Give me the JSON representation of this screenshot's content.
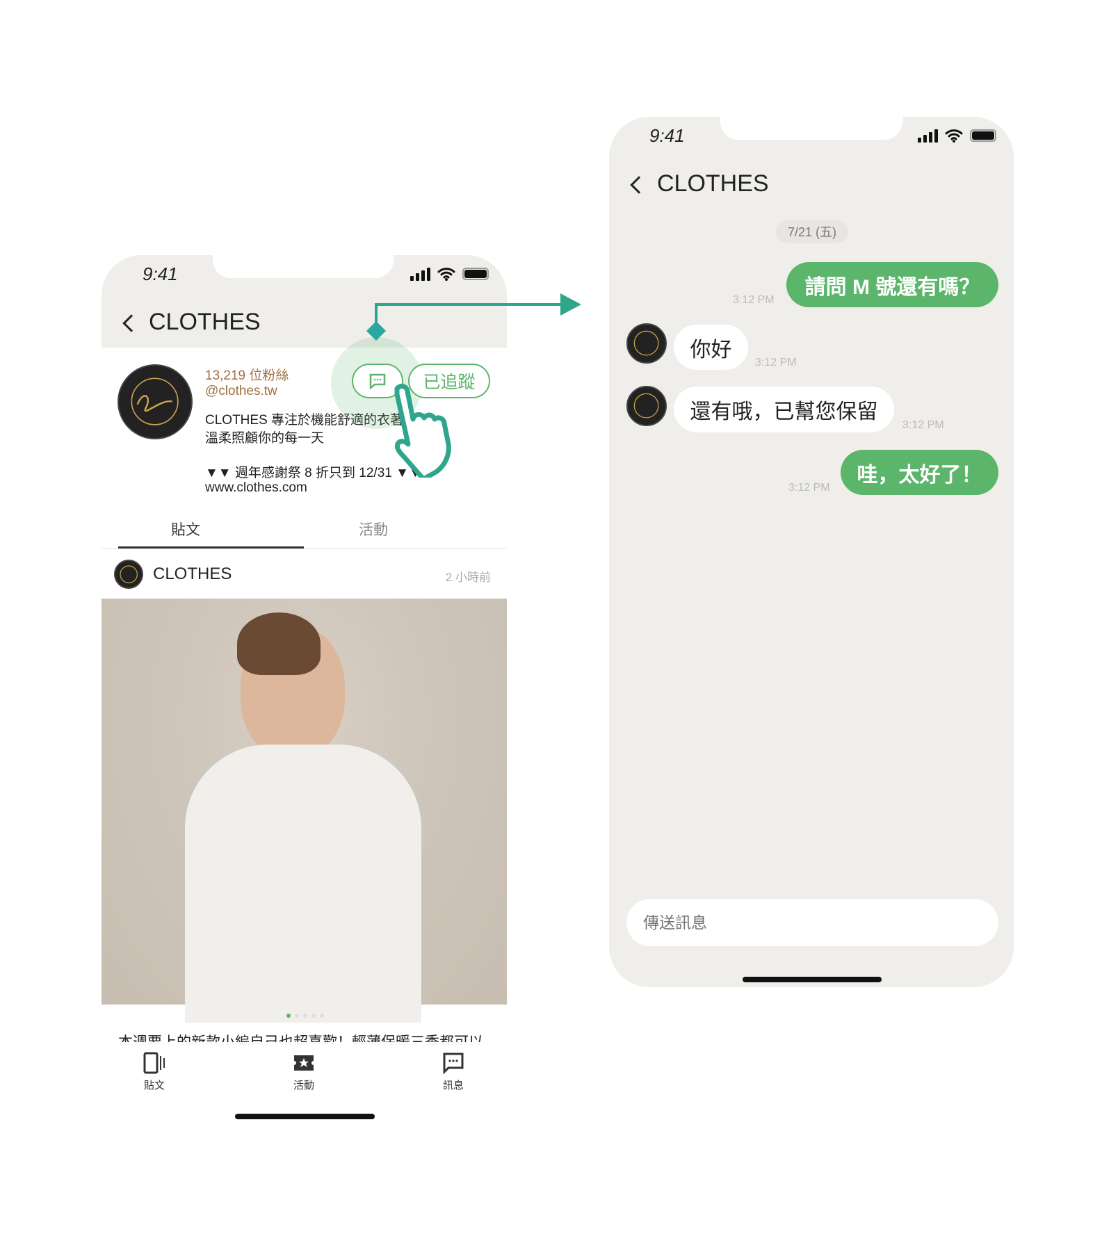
{
  "left_phone": {
    "status_time": "9:41",
    "header_title": "CLOTHES",
    "profile": {
      "followers": "13,219 位粉絲",
      "handle": "@clothes.tw",
      "bio_line1": "CLOTHES 專注於機能舒適的衣著，",
      "bio_line2": "溫柔照顧你的每一天",
      "promo": "▼▼ 週年感謝祭 8 折只到 12/31 ▼▼",
      "website": "www.clothes.com",
      "follow_label": "已追蹤"
    },
    "tabs": [
      {
        "label": "貼文",
        "active": true
      },
      {
        "label": "活動",
        "active": false
      }
    ],
    "post": {
      "author": "CLOTHES",
      "time": "2 小時前",
      "caption": "本週要上的新款小編自己也超喜歡！輕薄保暖三季都可以",
      "carousel_pages": 5,
      "carousel_active": 1
    },
    "bottom_nav": [
      {
        "label": "貼文",
        "icon": "posts-icon"
      },
      {
        "label": "活動",
        "icon": "event-ticket-icon"
      },
      {
        "label": "訊息",
        "icon": "message-icon"
      }
    ]
  },
  "right_phone": {
    "status_time": "9:41",
    "header_title": "CLOTHES",
    "date": "7/21 (五)",
    "messages": [
      {
        "from": "me",
        "text": "請問 M 號還有嗎？",
        "time": "3:12 PM"
      },
      {
        "from": "shop",
        "text": "你好",
        "time": "3:12 PM"
      },
      {
        "from": "shop",
        "text": "還有哦，已幫您保留",
        "time": "3:12 PM"
      },
      {
        "from": "me",
        "text": "哇，太好了！",
        "time": "3:12 PM"
      }
    ],
    "input_placeholder": "傳送訊息"
  },
  "colors": {
    "accent": "#5bb56a",
    "pointer": "#2fa58c",
    "followers": "#a0703f",
    "chat_bg": "#f0eeeb"
  }
}
